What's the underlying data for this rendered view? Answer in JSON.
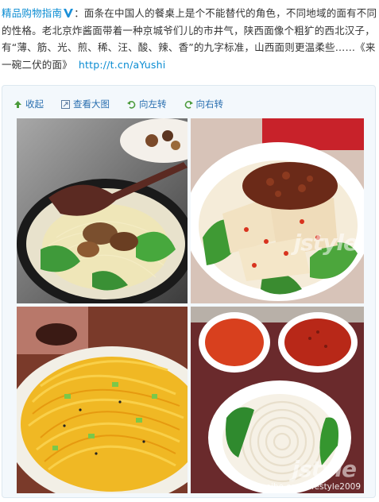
{
  "post": {
    "author": "精品购物指南",
    "text": "：面条在中国人的餐桌上是个不能替代的角色，不同地域的面有不同的性格。老北京炸酱面带着一种京城爷们儿的市井气，陕西面像个粗犷的西北汉子，有“薄、筋、光、煎、稀、汪、酸、辣、香”的九字标准，山西面则更温柔些……《来一碗二伏的面》",
    "link": "http://t.cn/aYushi"
  },
  "toolbar": {
    "collapse": "收起",
    "view_full": "查看大图",
    "rotate_left": "向左转",
    "rotate_right": "向右转"
  },
  "images": {
    "watermark": "jstyle",
    "credit": "weibo.com/lifestyle2009"
  },
  "colors": {
    "link": "#0a8cd2",
    "toolbar_link": "#2a6fb0",
    "media_bg": "#f3f8fc"
  }
}
